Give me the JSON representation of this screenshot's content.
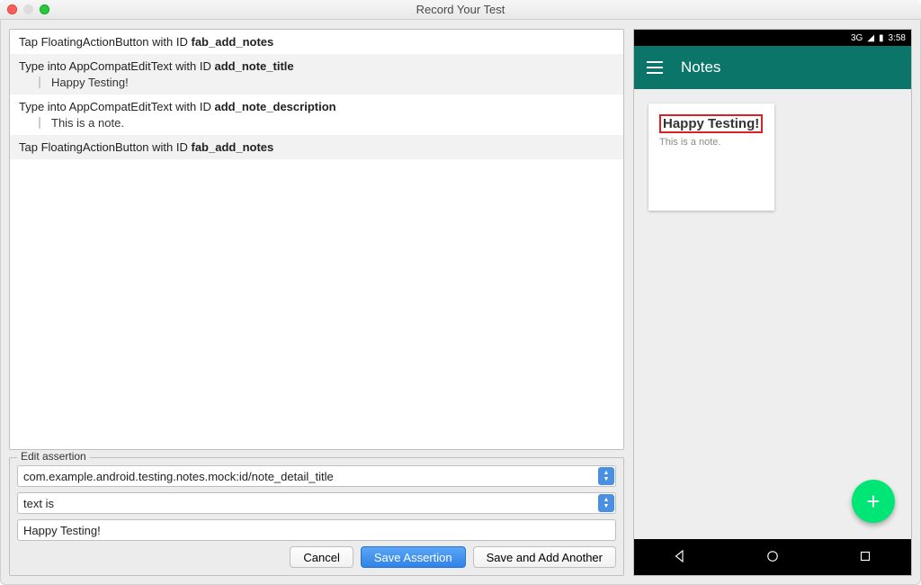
{
  "window": {
    "title": "Record Your Test"
  },
  "steps": [
    {
      "prefix": "Tap FloatingActionButton with ID ",
      "id": "fab_add_notes"
    },
    {
      "prefix": "Type into AppCompatEditText with ID ",
      "id": "add_note_title",
      "sub": "Happy Testing!"
    },
    {
      "prefix": "Type into AppCompatEditText with ID ",
      "id": "add_note_description",
      "sub": "This is a note."
    },
    {
      "prefix": "Tap FloatingActionButton with ID ",
      "id": "fab_add_notes"
    }
  ],
  "assertion": {
    "legend": "Edit assertion",
    "element": "com.example.android.testing.notes.mock:id/note_detail_title",
    "rule": "text is",
    "value": "Happy Testing!",
    "buttons": {
      "cancel": "Cancel",
      "save": "Save Assertion",
      "another": "Save and Add Another"
    }
  },
  "device": {
    "status": {
      "signal": "3G",
      "time": "3:58"
    },
    "app_title": "Notes",
    "note": {
      "title": "Happy Testing!",
      "desc": "This is a note."
    },
    "fab_symbol": "+"
  }
}
